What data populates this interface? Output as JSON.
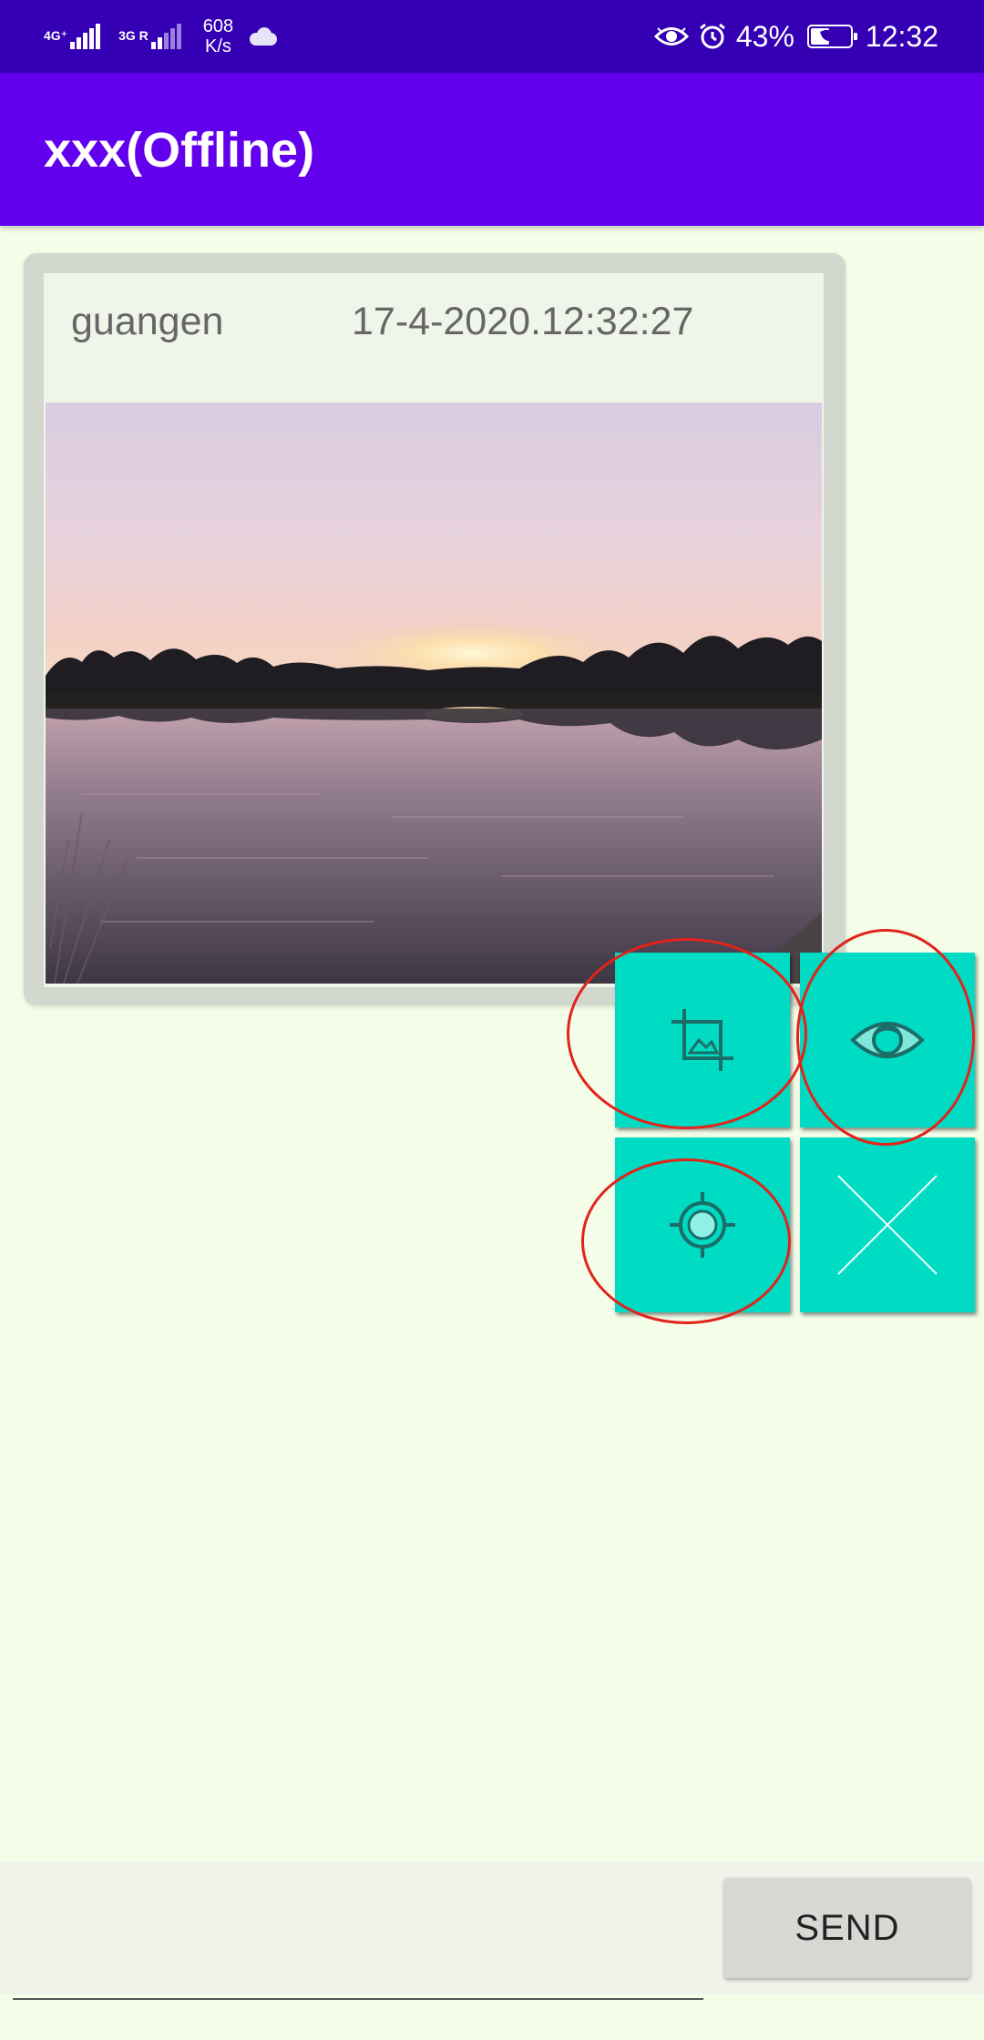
{
  "status_bar": {
    "network1": "4G⁺",
    "network2": "3G R",
    "speed_value": "608",
    "speed_unit": "K/s",
    "battery": "43%",
    "time": "12:32",
    "icons": [
      "signal-icon",
      "signal-icon",
      "cloud-icon",
      "eye-comfort-icon",
      "alarm-icon",
      "battery-icon"
    ]
  },
  "app_bar": {
    "title": "xxx(Offline)"
  },
  "message": {
    "sender": "guangen",
    "timestamp": "17-4-2020.12:32:27",
    "image": "sunset-lake-photo"
  },
  "actions": [
    {
      "name": "crop",
      "icon": "crop-icon"
    },
    {
      "name": "view",
      "icon": "eye-icon"
    },
    {
      "name": "locate",
      "icon": "target-icon"
    },
    {
      "name": "close",
      "icon": "close-icon"
    }
  ],
  "input_bar": {
    "message_value": "",
    "message_placeholder": "",
    "send_label": "SEND"
  },
  "colors": {
    "status_bar": "#3500b4",
    "app_bar": "#6200ee",
    "background": "#f3fde8",
    "tile": "#00dbc4",
    "annotation": "#e2231a"
  }
}
